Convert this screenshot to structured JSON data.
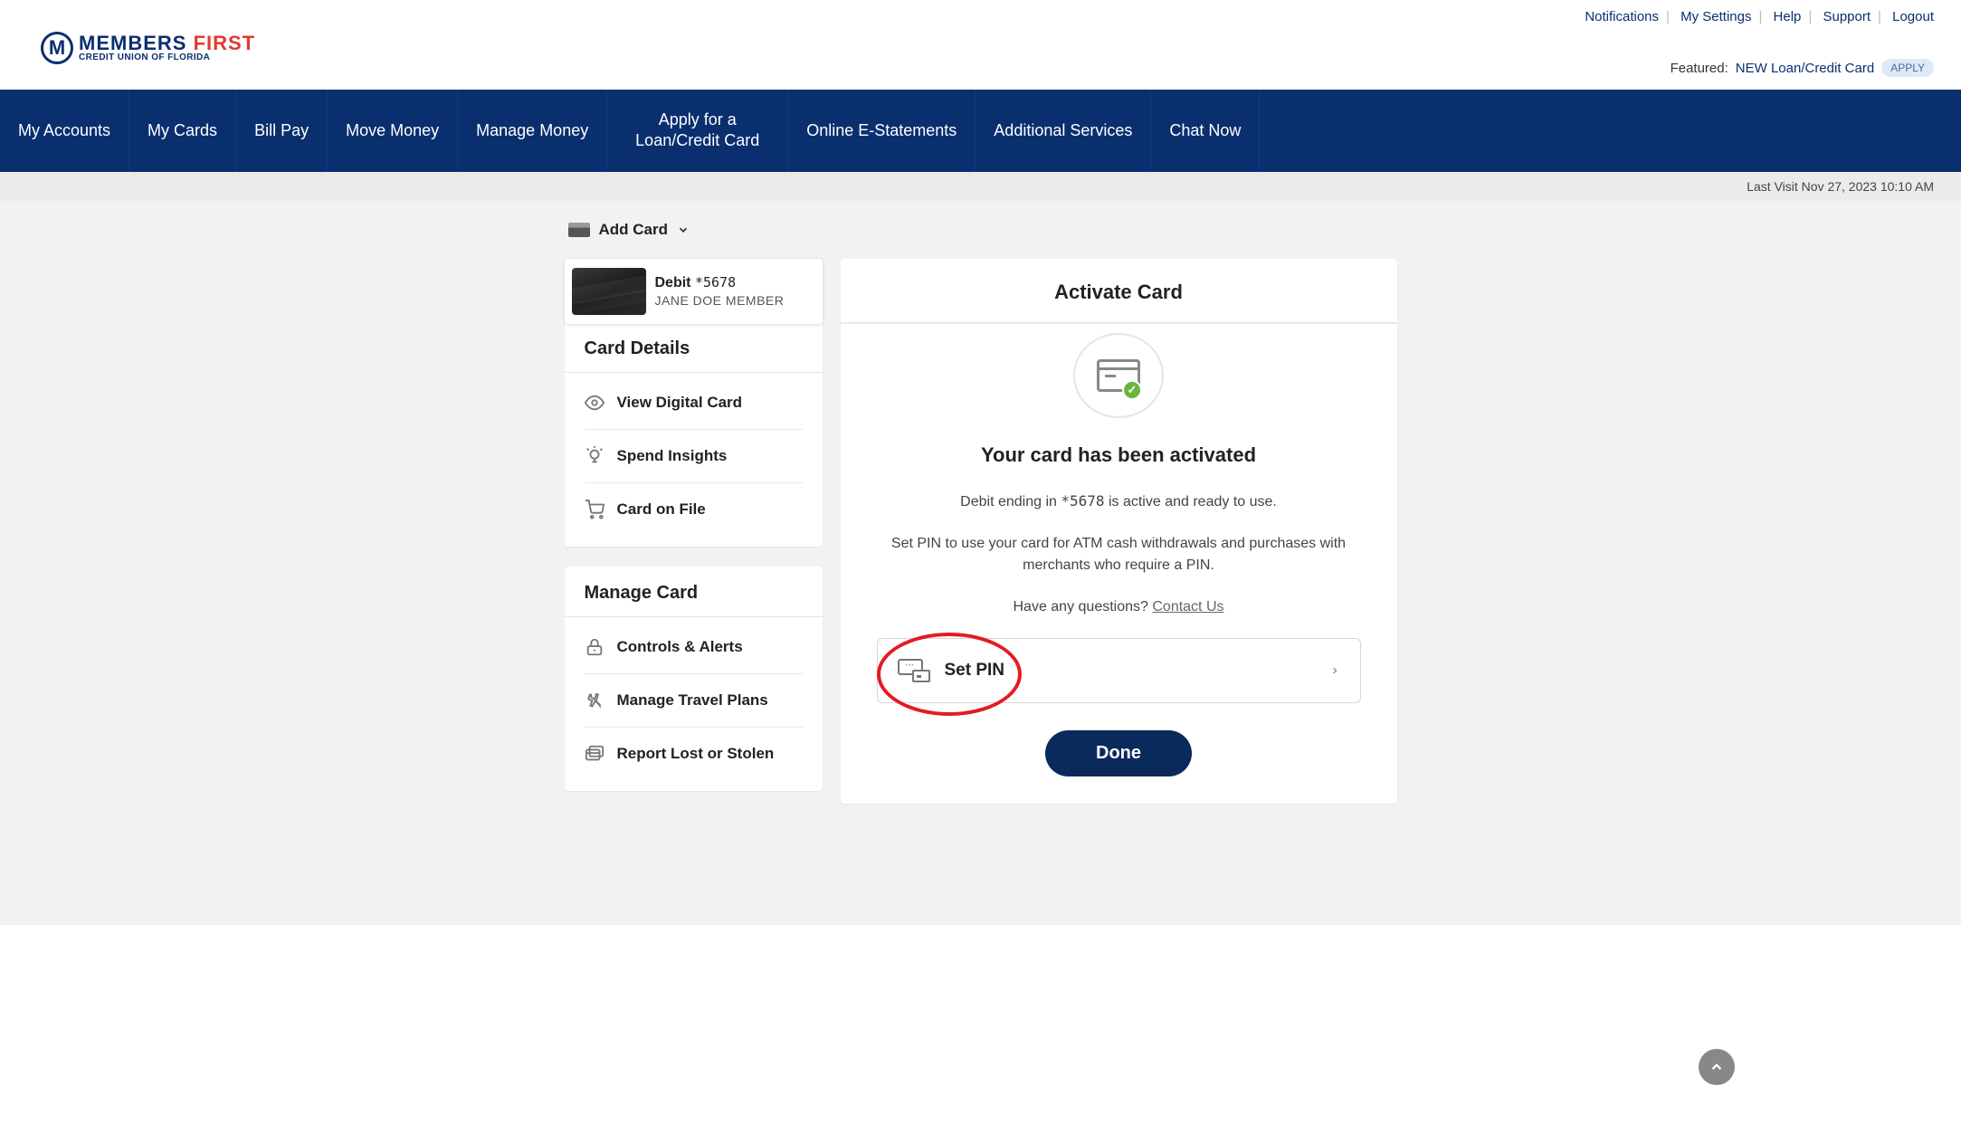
{
  "header": {
    "top_links": [
      "Notifications",
      "My Settings",
      "Help",
      "Support",
      "Logout"
    ],
    "logo_main_1": "MEMBERS",
    "logo_main_2": "FIRST",
    "logo_sub": "CREDIT UNION OF FLORIDA",
    "featured_label": "Featured:",
    "featured_link": "NEW Loan/Credit Card",
    "apply_label": "APPLY"
  },
  "nav": {
    "items": [
      "My Accounts",
      "My Cards",
      "Bill Pay",
      "Move Money",
      "Manage Money",
      "Apply for a Loan/Credit Card",
      "Online E-Statements",
      "Additional Services",
      "Chat Now"
    ]
  },
  "last_visit": "Last Visit Nov 27, 2023 10:10 AM",
  "add_card": {
    "label": "Add Card"
  },
  "card": {
    "type_label": "Debit",
    "mask": "*5678",
    "holder": "JANE DOE MEMBER"
  },
  "sidebar": {
    "panel1_title": "Card Details",
    "panel1_items": [
      "View Digital Card",
      "Spend Insights",
      "Card on File"
    ],
    "panel2_title": "Manage Card",
    "panel2_items": [
      "Controls & Alerts",
      "Manage Travel Plans",
      "Report Lost or Stolen"
    ]
  },
  "main": {
    "title": "Activate Card",
    "heading": "Your card has been activated",
    "line1_pre": "Debit ending in ",
    "line1_mask": "*5678",
    "line1_post": " is active and ready to use.",
    "line2": "Set PIN to use your card for ATM cash withdrawals and purchases with merchants who require a PIN.",
    "line3_pre": "Have any questions? ",
    "line3_link": "Contact Us",
    "setpin_label": "Set PIN",
    "done_label": "Done"
  }
}
